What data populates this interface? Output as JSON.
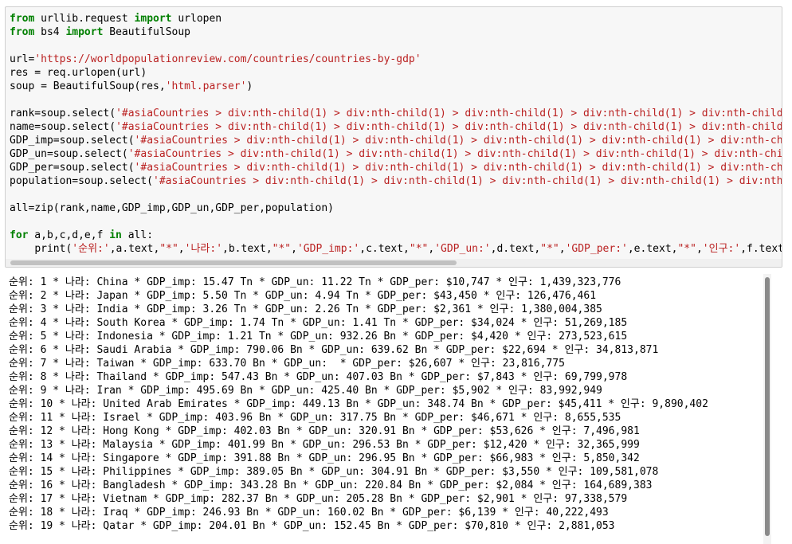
{
  "code": {
    "l1": {
      "kw1": "from",
      "t1": " urllib.request ",
      "kw2": "import",
      "t2": " urlopen"
    },
    "l2": {
      "kw1": "from",
      "t1": " bs4 ",
      "kw2": "import",
      "t2": " BeautifulSoup"
    },
    "l4": {
      "t1": "url=",
      "s1": "'https://worldpopulationreview.com/countries/countries-by-gdp'"
    },
    "l5": {
      "t1": "res = req.urlopen(url)"
    },
    "l6": {
      "t1": "soup = BeautifulSoup(res,",
      "s1": "'html.parser'",
      "t2": ")"
    },
    "l8": {
      "t1": "rank=soup.select(",
      "s1": "'#asiaCountries > div:nth-child(1) > div:nth-child(1) > div:nth-child(1) > div:nth-child(1) > div:nth-child(2) > div:nth-ch"
    },
    "l9": {
      "t1": "name=soup.select(",
      "s1": "'#asiaCountries > div:nth-child(1) > div:nth-child(1) > div:nth-child(1) > div:nth-child(1) > div:nth-child(2) > div:nth-c"
    },
    "l10": {
      "t1": "GDP_imp=soup.select(",
      "s1": "'#asiaCountries > div:nth-child(1) > div:nth-child(1) > div:nth-child(1) > div:nth-child(1) > div:nth-child(2) > div:nt"
    },
    "l11": {
      "t1": "GDP_un=soup.select(",
      "s1": "'#asiaCountries > div:nth-child(1) > div:nth-child(1) > div:nth-child(1) > div:nth-child(1) > div:nth-child(2) > div:nt"
    },
    "l12": {
      "t1": "GDP_per=soup.select(",
      "s1": "'#asiaCountries > div:nth-child(1) > div:nth-child(1) > div:nth-child(1) > div:nth-child(1) > div:nth-child(2) > div:nt"
    },
    "l13": {
      "t1": "population=soup.select(",
      "s1": "'#asiaCountries > div:nth-child(1) > div:nth-child(1) > div:nth-child(1) > div:nth-child(1) > div:nth-child(2) > div"
    },
    "l15": {
      "t1": "all=zip(rank,name,GDP_imp,GDP_un,GDP_per,population)"
    },
    "l17": {
      "kw1": "for",
      "t1": " a,b,c,d,e,f ",
      "kw2": "in",
      "t2": " all:"
    },
    "l18": {
      "indent": "    ",
      "t1": "print(",
      "s1": "'순위:'",
      "t2": ",a.text,",
      "s2": "\"*\"",
      "t3": ",",
      "s3": "'나라:'",
      "t4": ",b.text,",
      "s4": "\"*\"",
      "t5": ",",
      "s5": "'GDP_imp:'",
      "t6": ",c.text,",
      "s6": "\"*\"",
      "t7": ",",
      "s7": "'GDP_un:'",
      "t8": ",d.text,",
      "s8": "\"*\"",
      "t9": ",",
      "s9": "'GDP_per:'",
      "t10": ",e.text,",
      "s10": "\"*\"",
      "t11": ",",
      "s11": "'인구:'",
      "t12": ",f.text)"
    }
  },
  "output": [
    "순위: 1 * 나라: China * GDP_imp: 15.47 Tn * GDP_un: 11.22 Tn * GDP_per: $10,747 * 인구: 1,439,323,776",
    "순위: 2 * 나라: Japan * GDP_imp: 5.50 Tn * GDP_un: 4.94 Tn * GDP_per: $43,450 * 인구: 126,476,461",
    "순위: 3 * 나라: India * GDP_imp: 3.26 Tn * GDP_un: 2.26 Tn * GDP_per: $2,361 * 인구: 1,380,004,385",
    "순위: 4 * 나라: South Korea * GDP_imp: 1.74 Tn * GDP_un: 1.41 Tn * GDP_per: $34,024 * 인구: 51,269,185",
    "순위: 5 * 나라: Indonesia * GDP_imp: 1.21 Tn * GDP_un: 932.26 Bn * GDP_per: $4,420 * 인구: 273,523,615",
    "순위: 6 * 나라: Saudi Arabia * GDP_imp: 790.06 Bn * GDP_un: 639.62 Bn * GDP_per: $22,694 * 인구: 34,813,871",
    "순위: 7 * 나라: Taiwan * GDP_imp: 633.70 Bn * GDP_un:  * GDP_per: $26,607 * 인구: 23,816,775",
    "순위: 8 * 나라: Thailand * GDP_imp: 547.43 Bn * GDP_un: 407.03 Bn * GDP_per: $7,843 * 인구: 69,799,978",
    "순위: 9 * 나라: Iran * GDP_imp: 495.69 Bn * GDP_un: 425.40 Bn * GDP_per: $5,902 * 인구: 83,992,949",
    "순위: 10 * 나라: United Arab Emirates * GDP_imp: 449.13 Bn * GDP_un: 348.74 Bn * GDP_per: $45,411 * 인구: 9,890,402",
    "순위: 11 * 나라: Israel * GDP_imp: 403.96 Bn * GDP_un: 317.75 Bn * GDP_per: $46,671 * 인구: 8,655,535",
    "순위: 12 * 나라: Hong Kong * GDP_imp: 402.03 Bn * GDP_un: 320.91 Bn * GDP_per: $53,626 * 인구: 7,496,981",
    "순위: 13 * 나라: Malaysia * GDP_imp: 401.99 Bn * GDP_un: 296.53 Bn * GDP_per: $12,420 * 인구: 32,365,999",
    "순위: 14 * 나라: Singapore * GDP_imp: 391.88 Bn * GDP_un: 296.95 Bn * GDP_per: $66,983 * 인구: 5,850,342",
    "순위: 15 * 나라: Philippines * GDP_imp: 389.05 Bn * GDP_un: 304.91 Bn * GDP_per: $3,550 * 인구: 109,581,078",
    "순위: 16 * 나라: Bangladesh * GDP_imp: 343.28 Bn * GDP_un: 220.84 Bn * GDP_per: $2,084 * 인구: 164,689,383",
    "순위: 17 * 나라: Vietnam * GDP_imp: 282.37 Bn * GDP_un: 205.28 Bn * GDP_per: $2,901 * 인구: 97,338,579",
    "순위: 18 * 나라: Iraq * GDP_imp: 246.93 Bn * GDP_un: 160.02 Bn * GDP_per: $6,139 * 인구: 40,222,493",
    "순위: 19 * 나라: Qatar * GDP_imp: 204.01 Bn * GDP_un: 152.45 Bn * GDP_per: $70,810 * 인구: 2,881,053"
  ]
}
